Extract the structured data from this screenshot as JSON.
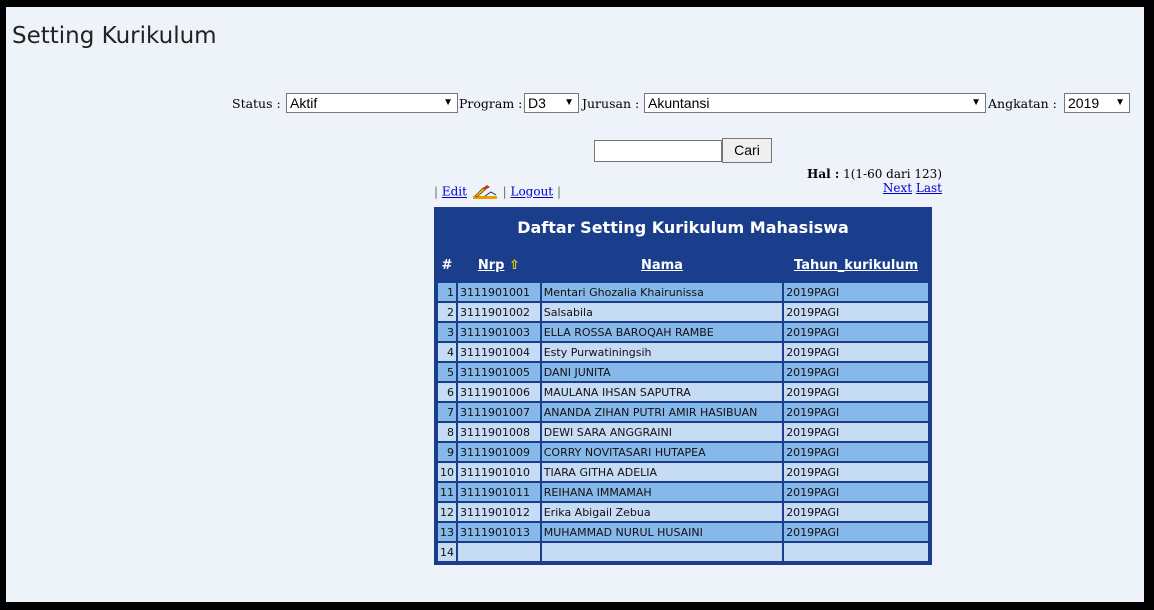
{
  "page": {
    "title": "Setting Kurikulum"
  },
  "filters": {
    "status": {
      "label": "Status :",
      "value": "Aktif"
    },
    "program": {
      "label": "Program :",
      "value": "D3"
    },
    "jurusan": {
      "label": "Jurusan :",
      "value": "Akuntansi"
    },
    "angkatan": {
      "label": "Angkatan :",
      "value": "2019"
    }
  },
  "search": {
    "value": "",
    "button_label": "Cari"
  },
  "pager": {
    "label": "Hal :",
    "info": "1(1-60 dari 123)",
    "next": "Next",
    "last": "Last"
  },
  "actions": {
    "edit": "Edit",
    "logout": "Logout"
  },
  "table": {
    "title": "Daftar Setting Kurikulum Mahasiswa",
    "columns": [
      "#",
      "Nrp",
      "Nama",
      "Tahun_kurikulum"
    ],
    "rows": [
      [
        "1",
        "3111901001",
        "Mentari Ghozalia Khairunissa",
        "2019PAGI"
      ],
      [
        "2",
        "3111901002",
        "Salsabila",
        "2019PAGI"
      ],
      [
        "3",
        "3111901003",
        "ELLA ROSSA BAROQAH RAMBE",
        "2019PAGI"
      ],
      [
        "4",
        "3111901004",
        "Esty Purwatiningsih",
        "2019PAGI"
      ],
      [
        "5",
        "3111901005",
        "DANI JUNITA",
        "2019PAGI"
      ],
      [
        "6",
        "3111901006",
        "MAULANA IHSAN SAPUTRA",
        "2019PAGI"
      ],
      [
        "7",
        "3111901007",
        "ANANDA ZIHAN PUTRI AMIR HASIBUAN",
        "2019PAGI"
      ],
      [
        "8",
        "3111901008",
        "DEWI SARA ANGGRAINI",
        "2019PAGI"
      ],
      [
        "9",
        "3111901009",
        "CORRY NOVITASARI HUTAPEA",
        "2019PAGI"
      ],
      [
        "10",
        "3111901010",
        "TIARA GITHA ADELIA",
        "2019PAGI"
      ],
      [
        "11",
        "3111901011",
        "REIHANA IMMAMAH",
        "2019PAGI"
      ],
      [
        "12",
        "3111901012",
        "Erika Abigail Zebua",
        "2019PAGI"
      ],
      [
        "13",
        "3111901013",
        "MUHAMMAD NURUL HUSAINI",
        "2019PAGI"
      ],
      [
        "14",
        "",
        "",
        ""
      ]
    ]
  },
  "colors": {
    "header_bg": "#1b3e8c",
    "row_odd": "#87b8ea",
    "row_even": "#c6dcf5",
    "sort_arrow": "#f5d900"
  }
}
